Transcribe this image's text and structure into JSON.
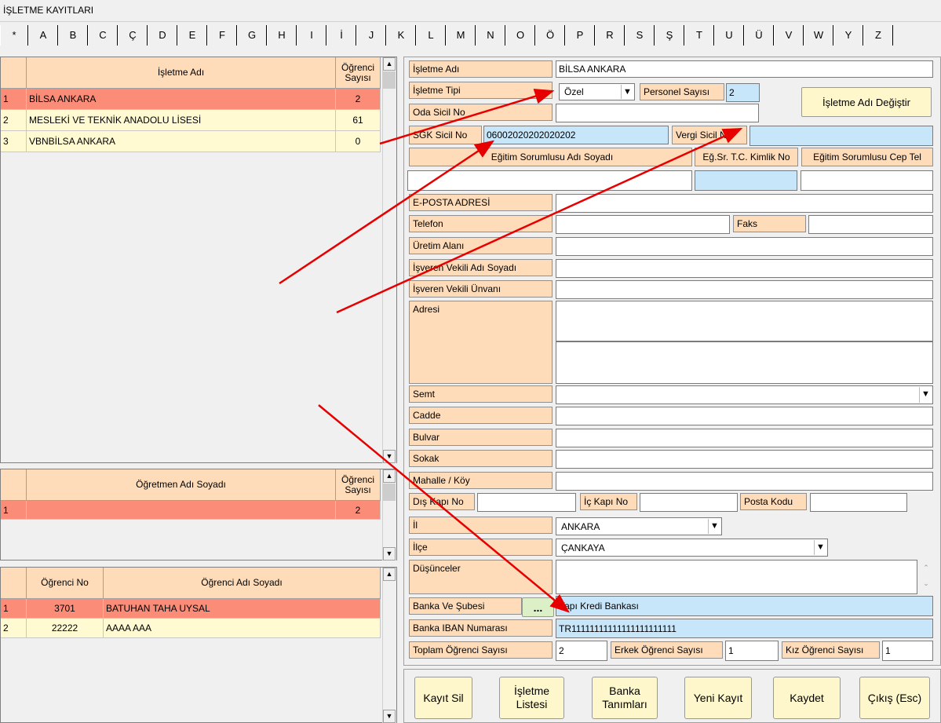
{
  "window": {
    "title": "İŞLETME KAYITLARI"
  },
  "alphabet": [
    "*",
    "A",
    "B",
    "C",
    "Ç",
    "D",
    "E",
    "F",
    "G",
    "H",
    "I",
    "İ",
    "J",
    "K",
    "L",
    "M",
    "N",
    "O",
    "Ö",
    "P",
    "R",
    "S",
    "Ş",
    "T",
    "U",
    "Ü",
    "V",
    "W",
    "Y",
    "Z"
  ],
  "businesses": {
    "headers": {
      "name": "İşletme Adı",
      "count_line1": "Öğrenci",
      "count_line2": "Sayısı"
    },
    "rows": [
      {
        "no": "1",
        "name": "BİLSA ANKARA",
        "count": "2"
      },
      {
        "no": "2",
        "name": "MESLEKİ VE TEKNİK ANADOLU LİSESİ",
        "count": "61"
      },
      {
        "no": "3",
        "name": "VBNBİLSA ANKARA",
        "count": "0"
      }
    ]
  },
  "teachers": {
    "headers": {
      "name": "Öğretmen Adı Soyadı",
      "count_line1": "Öğrenci",
      "count_line2": "Sayısı"
    },
    "rows": [
      {
        "no": "1",
        "name": "",
        "count": "2"
      }
    ]
  },
  "students": {
    "headers": {
      "no": "Öğrenci No",
      "name": "Öğrenci Adı Soyadı"
    },
    "rows": [
      {
        "idx": "1",
        "no": "3701",
        "name": "BATUHAN TAHA UYSAL"
      },
      {
        "idx": "2",
        "no": "22222",
        "name": "AAAA AAA"
      }
    ]
  },
  "form": {
    "isletme_adi_label": "İşletme Adı",
    "isletme_adi": "BİLSA ANKARA",
    "isletme_tipi_label": "İşletme Tipi",
    "isletme_tipi": "Özel",
    "personel_sayisi_label": "Personel Sayısı",
    "personel_sayisi": "2",
    "rename_button": "İşletme Adı Değiştir",
    "oda_sicil_label": "Oda Sicil No",
    "oda_sicil": "",
    "sgk_label": "SGK Sicil No",
    "sgk": "06002020202020202",
    "vergi_label": "Vergi Sicil No",
    "vergi": "",
    "egitim_sorumlusu_label": "Eğitim Sorumlusu Adı Soyadı",
    "egitim_tc_label": "Eğ.Sr. T.C. Kimlik No",
    "egitim_tel_label": "Eğitim Sorumlusu Cep Tel",
    "eposta_label": "E-POSTA ADRESİ",
    "telefon_label": "Telefon",
    "faks_label": "Faks",
    "uretim_label": "Üretim Alanı",
    "vekil_adi_label": "İşveren Vekili Adı Soyadı",
    "vekil_unvan_label": "İşveren Vekili Ünvanı",
    "adres_label": "Adresi",
    "semt_label": "Semt",
    "cadde_label": "Cadde",
    "bulvar_label": "Bulvar",
    "sokak_label": "Sokak",
    "mahalle_label": "Mahalle / Köy",
    "dis_kapi_label": "Dış Kapı No",
    "ic_kapi_label": "İç Kapı No",
    "posta_label": "Posta Kodu",
    "il_label": "İl",
    "il": "ANKARA",
    "ilce_label": "İlçe",
    "ilce": "ÇANKAYA",
    "dusunceler_label": "Düşünceler",
    "banka_label": "Banka Ve Şubesi",
    "banka_button": "...",
    "banka": "Yapı Kredi Bankası",
    "iban_label": "Banka IBAN Numarası",
    "iban": "TR11111111111111111111111",
    "toplam_label": "Toplam Öğrenci Sayısı",
    "toplam": "2",
    "erkek_label": "Erkek Öğrenci Sayısı",
    "erkek": "1",
    "kiz_label": "Kız Öğrenci Sayısı",
    "kiz": "1"
  },
  "buttons": {
    "kayit_sil": "Kayıt Sil",
    "isletme_listesi_1": "İşletme",
    "isletme_listesi_2": "Listesi",
    "banka_tanimlari_1": "Banka",
    "banka_tanimlari_2": "Tanımları",
    "yeni_kayit": "Yeni Kayıt",
    "kaydet": "Kaydet",
    "cikis": "Çıkış (Esc)"
  },
  "colors": {
    "label_bg": "#ffdcb9",
    "selected_row": "#fa8c78",
    "row_bg": "#fffad2",
    "highlight_blue": "#c8e6fa",
    "button_bg": "#fff7cc",
    "annotation_arrow": "#e60000"
  }
}
